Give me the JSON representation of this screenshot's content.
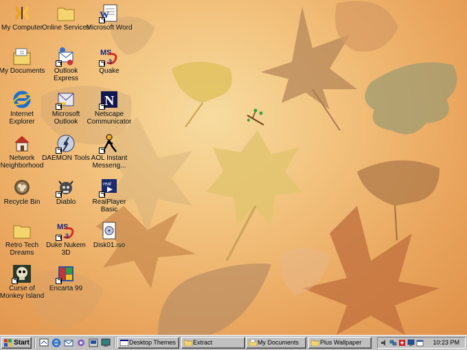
{
  "desktop": {
    "icons": [
      {
        "label": "My Computer",
        "icon": "my-computer-icon"
      },
      {
        "label": "Online Services",
        "icon": "folder-icon"
      },
      {
        "label": "Microsoft Word",
        "icon": "word-icon"
      },
      {
        "label": "My Documents",
        "icon": "my-documents-icon"
      },
      {
        "label": "Outlook Express",
        "icon": "outlook-express-icon"
      },
      {
        "label": "Quake",
        "icon": "quake-icon"
      },
      {
        "label": "Internet Explorer",
        "icon": "internet-explorer-icon"
      },
      {
        "label": "Microsoft Outlook",
        "icon": "outlook-icon"
      },
      {
        "label": "Netscape Communicator",
        "icon": "netscape-icon"
      },
      {
        "label": "Network Neighborhood",
        "icon": "network-icon"
      },
      {
        "label": "DAEMON Tools",
        "icon": "daemon-tools-icon"
      },
      {
        "label": "AOL Instant Messeng...",
        "icon": "aim-icon"
      },
      {
        "label": "Recycle Bin",
        "icon": "recycle-bin-icon"
      },
      {
        "label": "Diablo",
        "icon": "diablo-icon"
      },
      {
        "label": "RealPlayer Basic",
        "icon": "realplayer-icon"
      },
      {
        "label": "Retro Tech Dreams",
        "icon": "folder-icon"
      },
      {
        "label": "Duke Nukem 3D",
        "icon": "duke-nukem-icon"
      },
      {
        "label": "Disk01.iso",
        "icon": "disc-image-icon"
      },
      {
        "label": "Curse of Monkey Island",
        "icon": "monkey-island-icon"
      },
      {
        "label": "Encarta 99",
        "icon": "encarta-icon"
      }
    ]
  },
  "taskbar": {
    "start_label": "Start",
    "tasks": [
      {
        "label": "Desktop Themes"
      },
      {
        "label": "Extract"
      },
      {
        "label": "My Documents"
      },
      {
        "label": "Plus Wallpaper"
      }
    ],
    "clock": "10:23 PM"
  },
  "colors": {
    "taskbar": "#c0c0c0",
    "desktop_accent": "#e9a55d"
  }
}
